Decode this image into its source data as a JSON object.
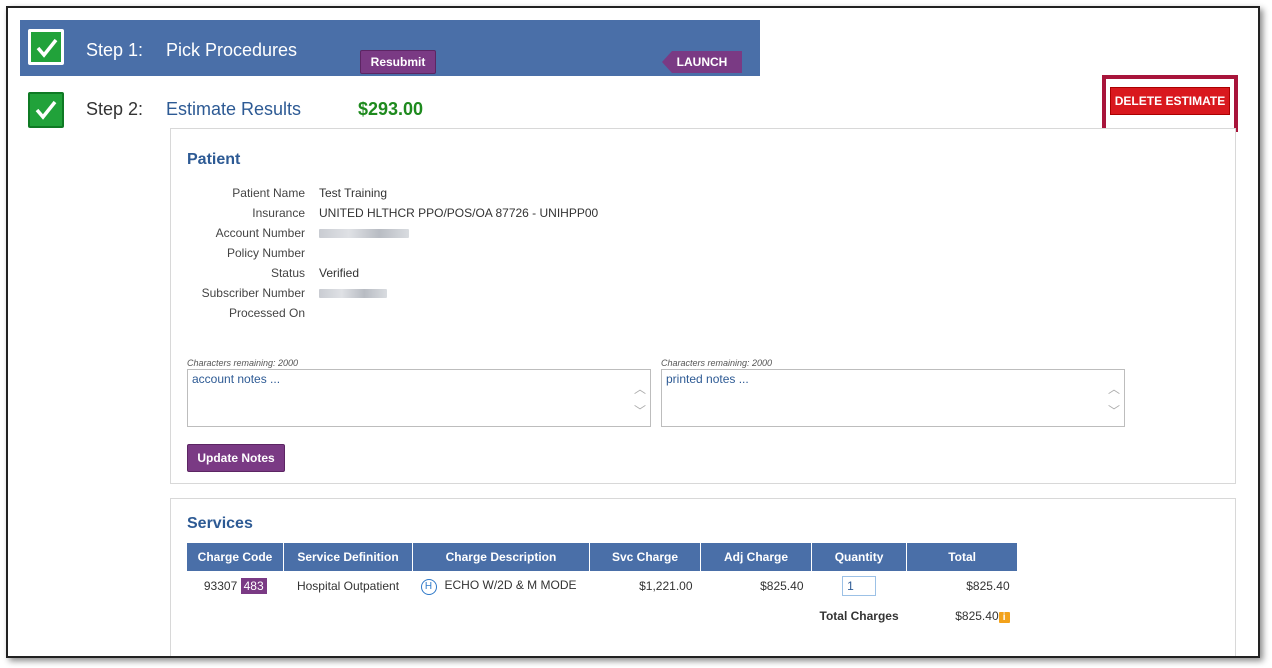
{
  "step1": {
    "num": "Step 1:",
    "title": "Pick Procedures",
    "resubmit": "Resubmit",
    "launch": "LAUNCH"
  },
  "step2": {
    "num": "Step 2:",
    "title": "Estimate Results",
    "amount": "$293.00",
    "delete": "DELETE ESTIMATE"
  },
  "patient": {
    "title": "Patient",
    "fields": [
      {
        "label": "Patient Name",
        "value": "Test Training"
      },
      {
        "label": "Insurance",
        "value": "UNITED HLTHCR PPO/POS/OA 87726 - UNIHPP00"
      },
      {
        "label": "Account Number",
        "value": ""
      },
      {
        "label": "Policy Number",
        "value": ""
      },
      {
        "label": "Status",
        "value": "Verified"
      },
      {
        "label": "Subscriber Number",
        "value": ""
      },
      {
        "label": "Processed On",
        "value": ""
      }
    ],
    "chars_remaining_1": "Characters remaining: 2000",
    "chars_remaining_2": "Characters remaining: 2000",
    "account_notes_placeholder": "account notes ...",
    "printed_notes_placeholder": "printed notes ...",
    "update_notes": "Update Notes"
  },
  "services": {
    "title": "Services",
    "headers": [
      "Charge Code",
      "Service Definition",
      "Charge Description",
      "Svc Charge",
      "Adj Charge",
      "Quantity",
      "Total"
    ],
    "row": {
      "code": "93307",
      "badge": "483",
      "service_definition": "Hospital Outpatient",
      "h_icon": "H",
      "description": "ECHO W/2D & M MODE",
      "svc_charge": "$1,221.00",
      "adj_charge": "$825.40",
      "quantity": "1",
      "total": "$825.40"
    },
    "total_label": "Total Charges",
    "total_value": "$825.40"
  },
  "colors": {
    "header_blue": "#4a6fa8",
    "purple": "#7a3a84",
    "green_amount": "#1e8a1e",
    "delete_red": "#d9181e"
  }
}
